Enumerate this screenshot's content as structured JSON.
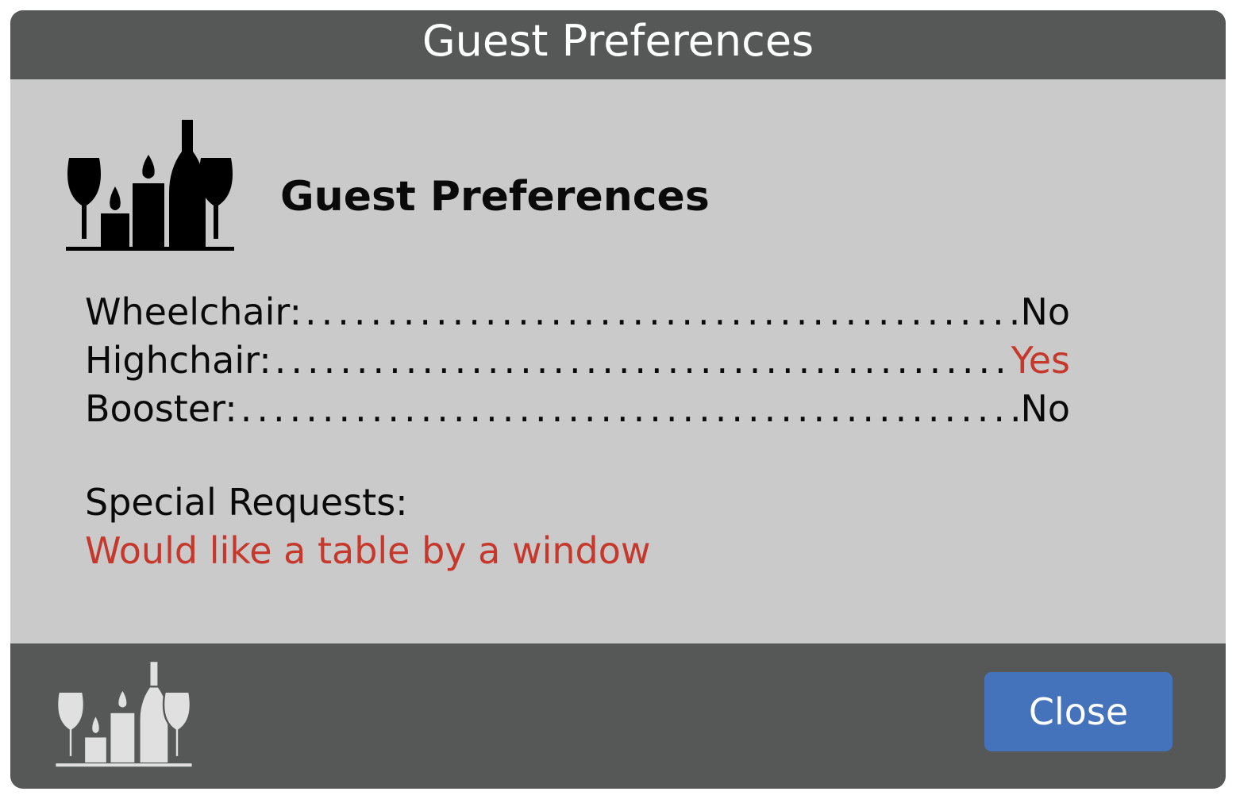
{
  "dialog": {
    "title": "Guest Preferences",
    "heading": "Guest Preferences",
    "heading_icon": "wine-candles-icon",
    "preferences": [
      {
        "label": "Wheelchair:",
        "value": "No",
        "highlight": false
      },
      {
        "label": "Highchair:",
        "value": "Yes",
        "highlight": true
      },
      {
        "label": "Booster:",
        "value": "No",
        "highlight": false
      }
    ],
    "special_requests_label": "Special Requests:",
    "special_requests_text": "Would like a table by a window",
    "footer_icon": "wine-candles-icon",
    "close_label": "Close"
  },
  "colors": {
    "titlebar": "#565857",
    "body": "#cacaca",
    "accent_red": "#c6372c",
    "button": "#4473bb"
  }
}
